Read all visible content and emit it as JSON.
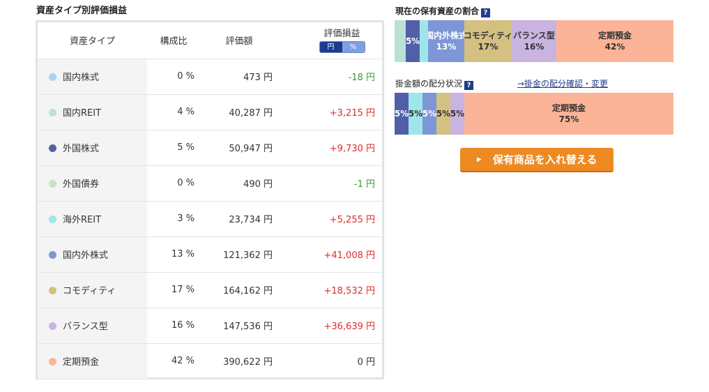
{
  "section_title": "資産タイプ別評価損益",
  "table": {
    "headers": {
      "asset_type": "資産タイプ",
      "ratio": "構成比",
      "value": "評価額",
      "gain": "評価損益"
    },
    "gain_toggle": {
      "yen": "円",
      "percent": "%",
      "selected": "円"
    },
    "rows": [
      {
        "name": "国内株式",
        "ratio": "0 %",
        "value": "473 円",
        "gain": "-18 円",
        "color": "#a9d4f5",
        "gain_color": "#3a9a3a"
      },
      {
        "name": "国内REIT",
        "ratio": "4 %",
        "value": "40,287 円",
        "gain": "+3,215 円",
        "color": "#b8e3d3",
        "gain_color": "#e02a2a"
      },
      {
        "name": "外国株式",
        "ratio": "5 %",
        "value": "50,947 円",
        "gain": "+9,730 円",
        "color": "#525fa8",
        "gain_color": "#e02a2a"
      },
      {
        "name": "外国債券",
        "ratio": "0 %",
        "value": "490 円",
        "gain": "-1 円",
        "color": "#c9e3c2",
        "gain_color": "#3a9a3a"
      },
      {
        "name": "海外REIT",
        "ratio": "3 %",
        "value": "23,734 円",
        "gain": "+5,255 円",
        "color": "#9ee6ea",
        "gain_color": "#e02a2a"
      },
      {
        "name": "国内外株式",
        "ratio": "13 %",
        "value": "121,362 円",
        "gain": "+41,008 円",
        "color": "#7d97d6",
        "gain_color": "#e02a2a"
      },
      {
        "name": "コモディティ",
        "ratio": "17 %",
        "value": "164,162 円",
        "gain": "+18,532 円",
        "color": "#d4c080",
        "gain_color": "#e02a2a"
      },
      {
        "name": "バランス型",
        "ratio": "16 %",
        "value": "147,536 円",
        "gain": "+36,639 円",
        "color": "#c9b3e0",
        "gain_color": "#e02a2a"
      },
      {
        "name": "定期預金",
        "ratio": "42 %",
        "value": "390,622 円",
        "gain": "0 円",
        "color": "#fbb497",
        "gain_color": "#333333"
      }
    ]
  },
  "holding_ratio": {
    "title": "現在の保有資産の割合",
    "help": "?",
    "segments": [
      {
        "label": "",
        "pct": "",
        "value": 4,
        "color": "#b8e3d3",
        "text_color": "#333333"
      },
      {
        "label": "",
        "pct": "5%",
        "value": 5,
        "color": "#525fa8",
        "text_color": "#ffffff"
      },
      {
        "label": "",
        "pct": "",
        "value": 3,
        "color": "#9ee6ea",
        "text_color": "#333333"
      },
      {
        "label": "国内外株式",
        "pct": "13%",
        "value": 13,
        "color": "#7d97d6",
        "text_color": "#ffffff"
      },
      {
        "label": "コモディティ",
        "pct": "17%",
        "value": 17,
        "color": "#d4c080",
        "text_color": "#333333"
      },
      {
        "label": "バランス型",
        "pct": "16%",
        "value": 16,
        "color": "#c9b3e0",
        "text_color": "#333333"
      },
      {
        "label": "定期預金",
        "pct": "42%",
        "value": 42,
        "color": "#fbb497",
        "text_color": "#333333"
      }
    ]
  },
  "allocation": {
    "title": "掛金額の配分状況",
    "help": "?",
    "link": "→掛金の配分確認・変更",
    "segments": [
      {
        "label": "",
        "pct": "5%",
        "value": 5,
        "color": "#525fa8",
        "text_color": "#ffffff"
      },
      {
        "label": "",
        "pct": "5%",
        "value": 5,
        "color": "#9ee6ea",
        "text_color": "#333333"
      },
      {
        "label": "",
        "pct": "5%",
        "value": 5,
        "color": "#7d97d6",
        "text_color": "#ffffff"
      },
      {
        "label": "",
        "pct": "5%",
        "value": 5,
        "color": "#d4c080",
        "text_color": "#333333"
      },
      {
        "label": "",
        "pct": "5%",
        "value": 5,
        "color": "#c9b3e0",
        "text_color": "#333333"
      },
      {
        "label": "定期預金",
        "pct": "75%",
        "value": 75,
        "color": "#fbb497",
        "text_color": "#333333"
      }
    ]
  },
  "swap_button": {
    "label": "保有商品を入れ替える",
    "arrow": "▶"
  }
}
